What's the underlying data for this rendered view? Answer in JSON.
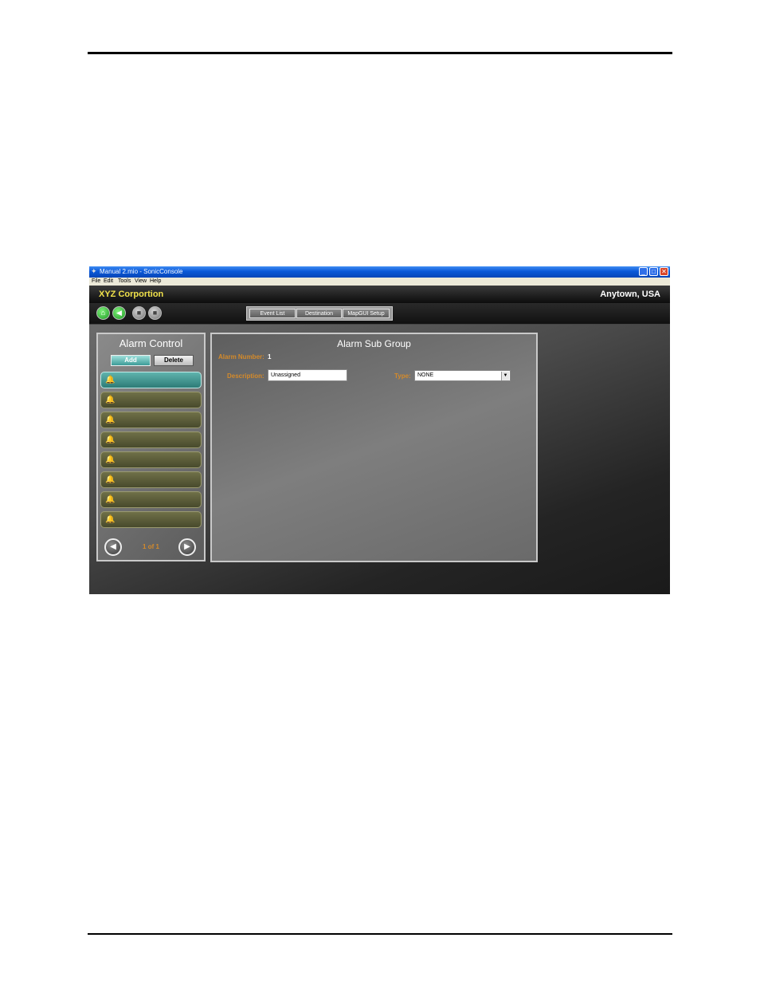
{
  "window": {
    "title": "Manual 2.mio - SonicConsole",
    "menu": [
      "File",
      "Edit",
      "Tools",
      "View",
      "Help"
    ]
  },
  "header": {
    "company": "XYZ Corportion",
    "location": "Anytown, USA"
  },
  "toolbar": {
    "tabs": [
      "Event List",
      "Destination",
      "MapGUI Setup"
    ]
  },
  "alarm_control": {
    "title": "Alarm Control",
    "add_label": "Add",
    "delete_label": "Delete",
    "pager": "1 of 1"
  },
  "alarm_sub_group": {
    "title": "Alarm Sub Group",
    "alarm_number_label": "Alarm Number:",
    "alarm_number_value": "1",
    "description_label": "Description:",
    "description_value": "Unassigned",
    "type_label": "Type:",
    "type_value": "NONE"
  },
  "colors": {
    "company_text": "#f0e14a",
    "label_orange": "#d48a2a",
    "selected_item": "#2d7c77"
  }
}
